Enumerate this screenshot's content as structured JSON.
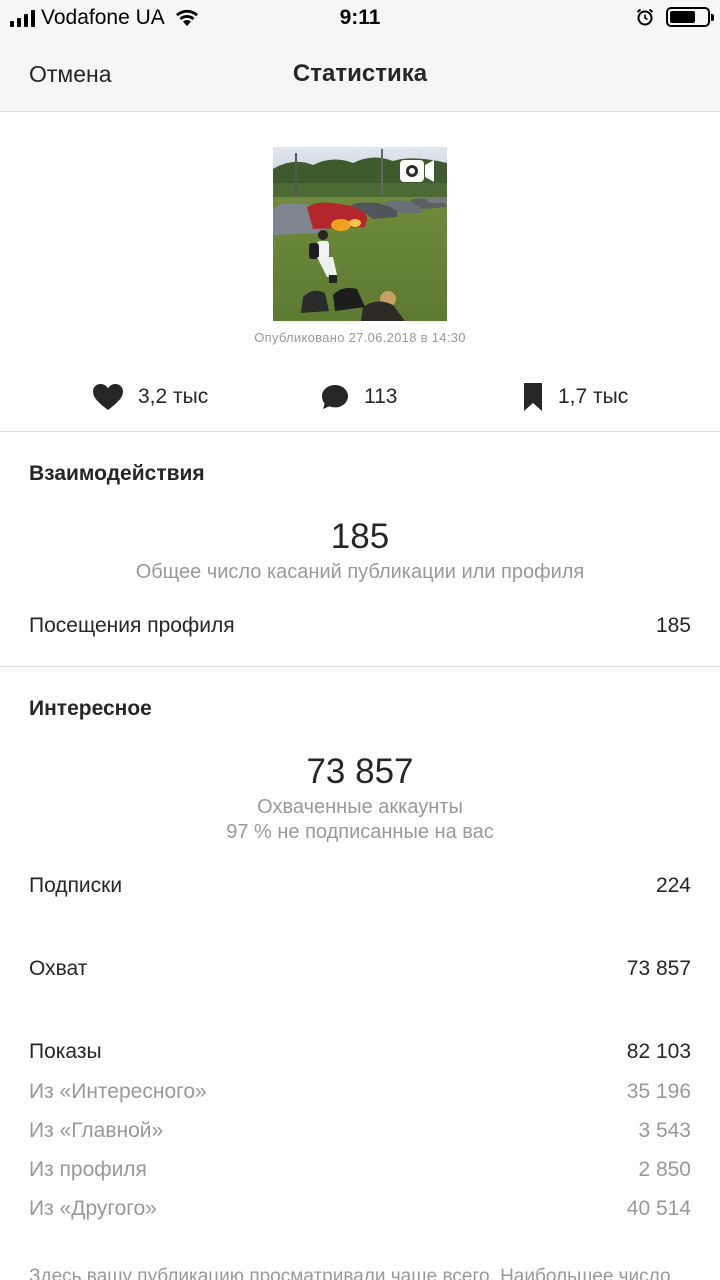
{
  "status_bar": {
    "carrier": "Vodafone UA",
    "time": "9:11"
  },
  "nav": {
    "cancel_label": "Отмена",
    "title": "Статистика"
  },
  "post": {
    "published": "Опубликовано 27.06.2018 в 14:30",
    "media_icon": "video-icon"
  },
  "metrics": {
    "likes": "3,2 тыс",
    "comments": "113",
    "saves": "1,7 тыс"
  },
  "interactions": {
    "title": "Взаимодействия",
    "total": "185",
    "total_caption": "Общее число касаний публикации или профиля",
    "rows": [
      {
        "label": "Посещения профиля",
        "value": "185"
      }
    ]
  },
  "discovery": {
    "title": "Интересное",
    "total": "73 857",
    "caption_line1": "Охваченные аккаунты",
    "caption_line2": "97 % не подписанные на вас",
    "follows": {
      "label": "Подписки",
      "value": "224"
    },
    "reach": {
      "label": "Охват",
      "value": "73 857"
    },
    "impressions": {
      "label": "Показы",
      "value": "82 103"
    },
    "impression_sources": [
      {
        "label": "Из «Интересного»",
        "value": "35 196"
      },
      {
        "label": "Из «Главной»",
        "value": "3 543"
      },
      {
        "label": "Из профиля",
        "value": "2 850"
      },
      {
        "label": "Из «Другого»",
        "value": "40 514"
      }
    ]
  },
  "footer_note": "Здесь вашу публикацию просматривали чаще всего. Наибольшее число",
  "colors": {
    "text": "#262626",
    "muted": "#999999",
    "divider": "#dbdbdb",
    "bar_bg": "#f6f6f6"
  }
}
